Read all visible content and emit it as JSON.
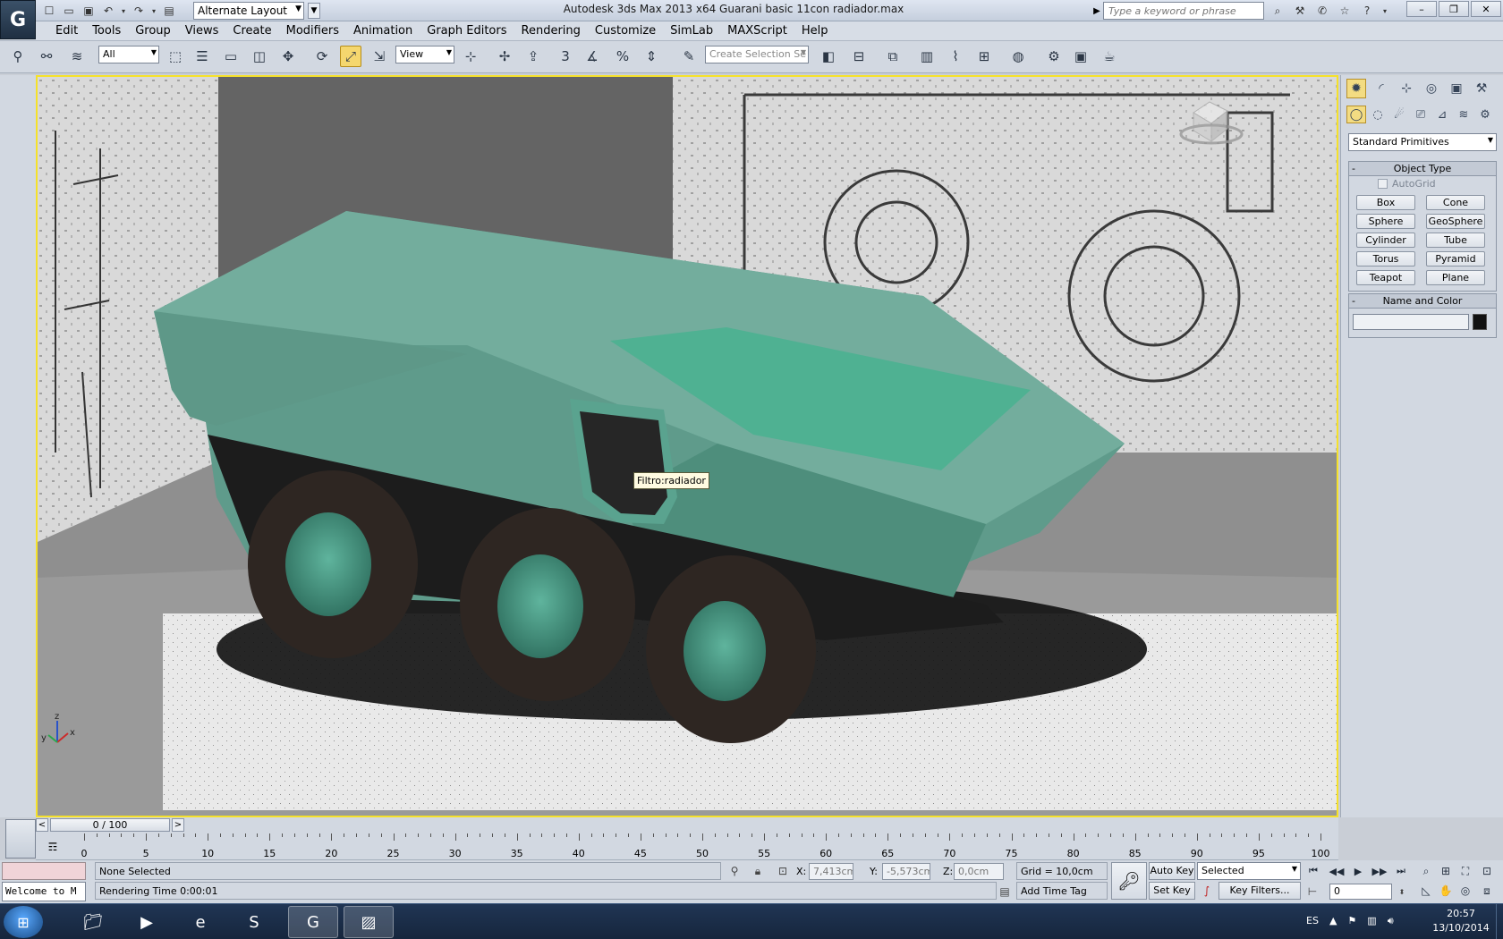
{
  "window": {
    "title": "Autodesk 3ds Max  2013 x64     Guarani basic 11con radiador.max",
    "workspace": "Alternate Layout",
    "search_placeholder": "Type a keyword or phrase",
    "minimize": "–",
    "restore": "❐",
    "close": "✕"
  },
  "menu": [
    "Edit",
    "Tools",
    "Group",
    "Views",
    "Create",
    "Modifiers",
    "Animation",
    "Graph Editors",
    "Rendering",
    "Customize",
    "SimLab",
    "MAXScript",
    "Help"
  ],
  "toolbar": {
    "filter": "All",
    "ref_coord": "View",
    "snap_label": "3",
    "selection_set_placeholder": "Create Selection Se"
  },
  "viewport": {
    "tooltip": "Filtro:radiador",
    "axis_x": "x",
    "axis_y": "y",
    "axis_z": "z"
  },
  "command_panel": {
    "dropdown": "Standard Primitives",
    "object_type_title": "Object Type",
    "autogrid": "AutoGrid",
    "buttons": [
      "Box",
      "Cone",
      "Sphere",
      "GeoSphere",
      "Cylinder",
      "Tube",
      "Torus",
      "Pyramid",
      "Teapot",
      "Plane"
    ],
    "name_color_title": "Name and Color"
  },
  "timeline": {
    "frame_display": "0 / 100",
    "ticks": [
      "0",
      "5",
      "10",
      "15",
      "20",
      "25",
      "30",
      "35",
      "40",
      "45",
      "50",
      "55",
      "60",
      "65",
      "70",
      "75",
      "80",
      "85",
      "90",
      "95",
      "100"
    ]
  },
  "status": {
    "listener": "Welcome to M",
    "selection": "None Selected",
    "rendering_time": "Rendering Time  0:00:01",
    "x_label": "X:",
    "x_value": "7,413cm",
    "y_label": "Y:",
    "y_value": "-5,573cm",
    "z_label": "Z:",
    "z_value": "0,0cm",
    "grid": "Grid = 10,0cm",
    "add_time_tag": "Add Time Tag",
    "auto_key": "Auto Key",
    "set_key": "Set Key",
    "selected": "Selected",
    "key_filters": "Key Filters...",
    "current_frame": "0"
  },
  "taskbar": {
    "lang": "ES",
    "time": "20:57",
    "date": "13/10/2014"
  }
}
